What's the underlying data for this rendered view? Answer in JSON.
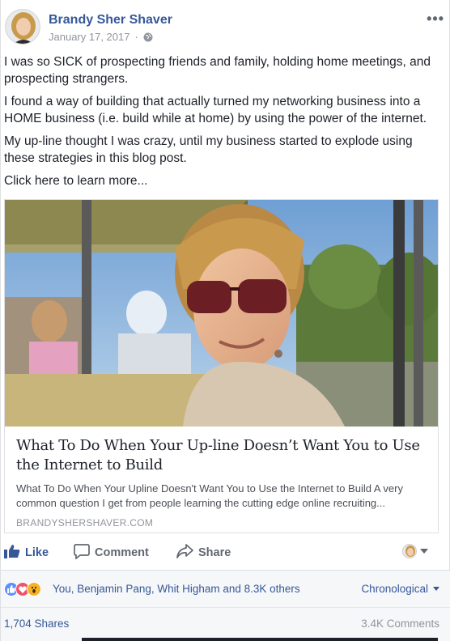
{
  "post": {
    "author": "Brandy Sher Shaver",
    "date": "January 17, 2017",
    "separator": "·",
    "more_label": "•••",
    "paragraphs": [
      "I was so SICK of prospecting friends and family, holding home meetings, and prospecting strangers.",
      "I found a way of building that actually turned my networking business into a HOME business (i.e. build while at home) by using the power of the internet.",
      "My up-line thought I was crazy, until my business started to explode using these strategies in this blog post.",
      "Click here to learn more..."
    ]
  },
  "link": {
    "title": "What To Do When Your Up-line Doesn’t Want You to Use the Internet to Build",
    "description": "What To Do When Your Upline Doesn't Want You to Use the Internet to Build A very common question I get from people learning the cutting edge online recruiting...",
    "domain": "BRANDYSHERSHAVER.COM"
  },
  "actions": {
    "like": "Like",
    "comment": "Comment",
    "share": "Share"
  },
  "reactions": {
    "summary": "You, Benjamin Pang, Whit Higham and 8.3K others",
    "order": "Chronological"
  },
  "counts": {
    "shares": "1,704 Shares",
    "comments": "3.4K Comments"
  },
  "colors": {
    "link_blue": "#365899",
    "like_blue": "#5890ff",
    "love_red": "#f25268",
    "wow_yellow": "#f7b125"
  }
}
